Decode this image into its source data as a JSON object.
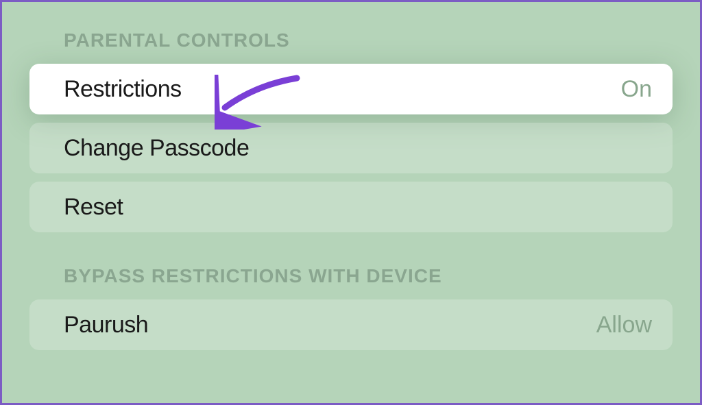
{
  "sections": {
    "parental_controls": {
      "header": "PARENTAL CONTROLS",
      "restrictions": {
        "label": "Restrictions",
        "value": "On"
      },
      "change_passcode": {
        "label": "Change Passcode"
      },
      "reset": {
        "label": "Reset"
      }
    },
    "bypass": {
      "header": "BYPASS RESTRICTIONS WITH DEVICE",
      "device": {
        "label": "Paurush",
        "value": "Allow"
      }
    }
  }
}
